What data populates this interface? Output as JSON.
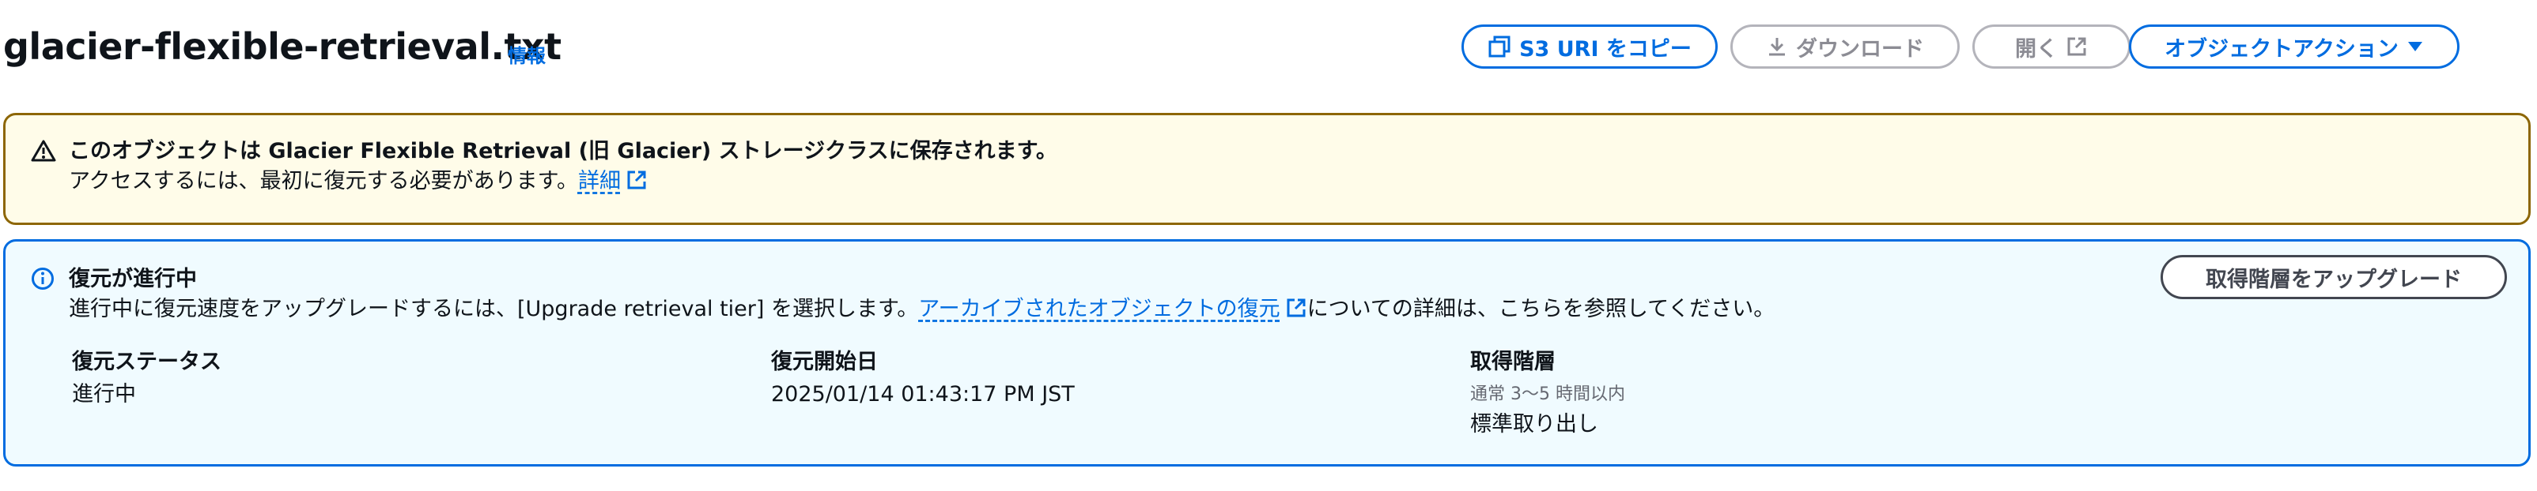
{
  "header": {
    "title": "glacier-flexible-retrieval.txt",
    "info_label": "情報",
    "buttons": {
      "copy_uri": "S3 URI をコピー",
      "download": "ダウンロード",
      "open": "開く",
      "object_actions": "オブジェクトアクション"
    }
  },
  "warning": {
    "title": "このオブジェクトは Glacier Flexible Retrieval (旧 Glacier) ストレージクラスに保存されます。",
    "body": "アクセスするには、最初に復元する必要があります。",
    "link": "詳細",
    "icon": "warning-icon"
  },
  "restore": {
    "title": "復元が進行中",
    "body_before": "進行中に復元速度をアップグレードするには、[Upgrade retrieval tier] を選択します。",
    "link": "アーカイブされたオブジェクトの復元",
    "body_after": "についての詳細は、こちらを参照してください。",
    "upgrade_button": "取得階層をアップグレード",
    "icon": "info-icon",
    "fields": {
      "status_label": "復元ステータス",
      "status_value": "進行中",
      "start_label": "復元開始日",
      "start_value": "2025/01/14 01:43:17 PM JST",
      "tier_label": "取得階層",
      "tier_hint": "通常 3～5 時間以内",
      "tier_value": "標準取り出し"
    }
  },
  "colors": {
    "primary": "#006ce0",
    "warning_border": "#8d6605",
    "warning_bg": "#fffce9",
    "info_border": "#006ce0",
    "info_bg": "#f0fbff",
    "disabled": "#8c8c94"
  }
}
